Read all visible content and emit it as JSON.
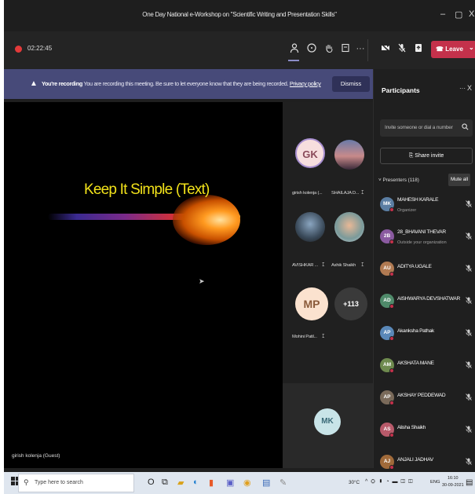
{
  "window": {
    "title": "One Day National e-Workshop on \"Scientific Writing and Presentation Skills\"",
    "minimize": "–",
    "restore": "▢",
    "close": "X"
  },
  "toolbar": {
    "timer": "02:22:45",
    "leave_label": "Leave",
    "leave_dropdown": "⌄"
  },
  "banner": {
    "bold": "You're recording",
    "text": "You are recording this meeting. Be sure to let everyone know that they are being recorded.",
    "link": "Privacy policy",
    "dismiss": "Dismiss"
  },
  "stage": {
    "slide_title": "Keep It Simple (Text)",
    "presenter_label": "girish kolenja (Guest)"
  },
  "tiles": [
    {
      "initials": "GK",
      "name": "girish kolenja (..."
    },
    {
      "initials": "",
      "name": "SHAILAJA D..."
    },
    {
      "initials": "",
      "name": "AVISHKAR ..."
    },
    {
      "initials": "",
      "name": "Ashik Shaikh"
    },
    {
      "initials": "MP",
      "name": "Mohini Patil..."
    },
    {
      "initials": "+113",
      "name": ""
    }
  ],
  "self_tile": {
    "initials": "MK"
  },
  "panel": {
    "title": "Participants",
    "more": "···",
    "close": "X",
    "invite_placeholder": "Invite someone or dial a number",
    "share_invite": "Share invite",
    "presenters_label": "Presenters (118)",
    "mute_all": "Mute all",
    "participants": [
      {
        "initials": "MK",
        "name": "MAHESH KARALE",
        "sub": "Organizer",
        "color": "#5b7ea3"
      },
      {
        "initials": "2B",
        "name": "28_BHAVANI THEVAR",
        "sub": "Outside your organization",
        "color": "#8a5aa0"
      },
      {
        "initials": "AU",
        "name": "ADITYA UGALE",
        "sub": "",
        "color": "#b07a52"
      },
      {
        "initials": "AD",
        "name": "AISHWARYA DEVSHATWAR",
        "sub": "",
        "color": "#4f8a6a"
      },
      {
        "initials": "AP",
        "name": "Akanksha Pathak",
        "sub": "",
        "color": "#5a88b8"
      },
      {
        "initials": "AM",
        "name": "AKSHATA MANE",
        "sub": "",
        "color": "#6e8a4e"
      },
      {
        "initials": "AP",
        "name": "AKSHAY PEDDEWAD",
        "sub": "",
        "color": "#7a6a5a"
      },
      {
        "initials": "AS",
        "name": "Alisha Shaikh",
        "sub": "",
        "color": "#b85a6a"
      },
      {
        "initials": "AJ",
        "name": "ANJALI JADHAV",
        "sub": "",
        "color": "#a06a3a"
      }
    ]
  },
  "taskbar": {
    "search_placeholder": "Type here to search",
    "weather": "30°C",
    "lang": "ENG",
    "time": "16:10",
    "date": "30-09-2021"
  },
  "colors": {
    "leave": "#c4314b",
    "banner": "#474a79",
    "slide_title": "#f2e21a"
  }
}
